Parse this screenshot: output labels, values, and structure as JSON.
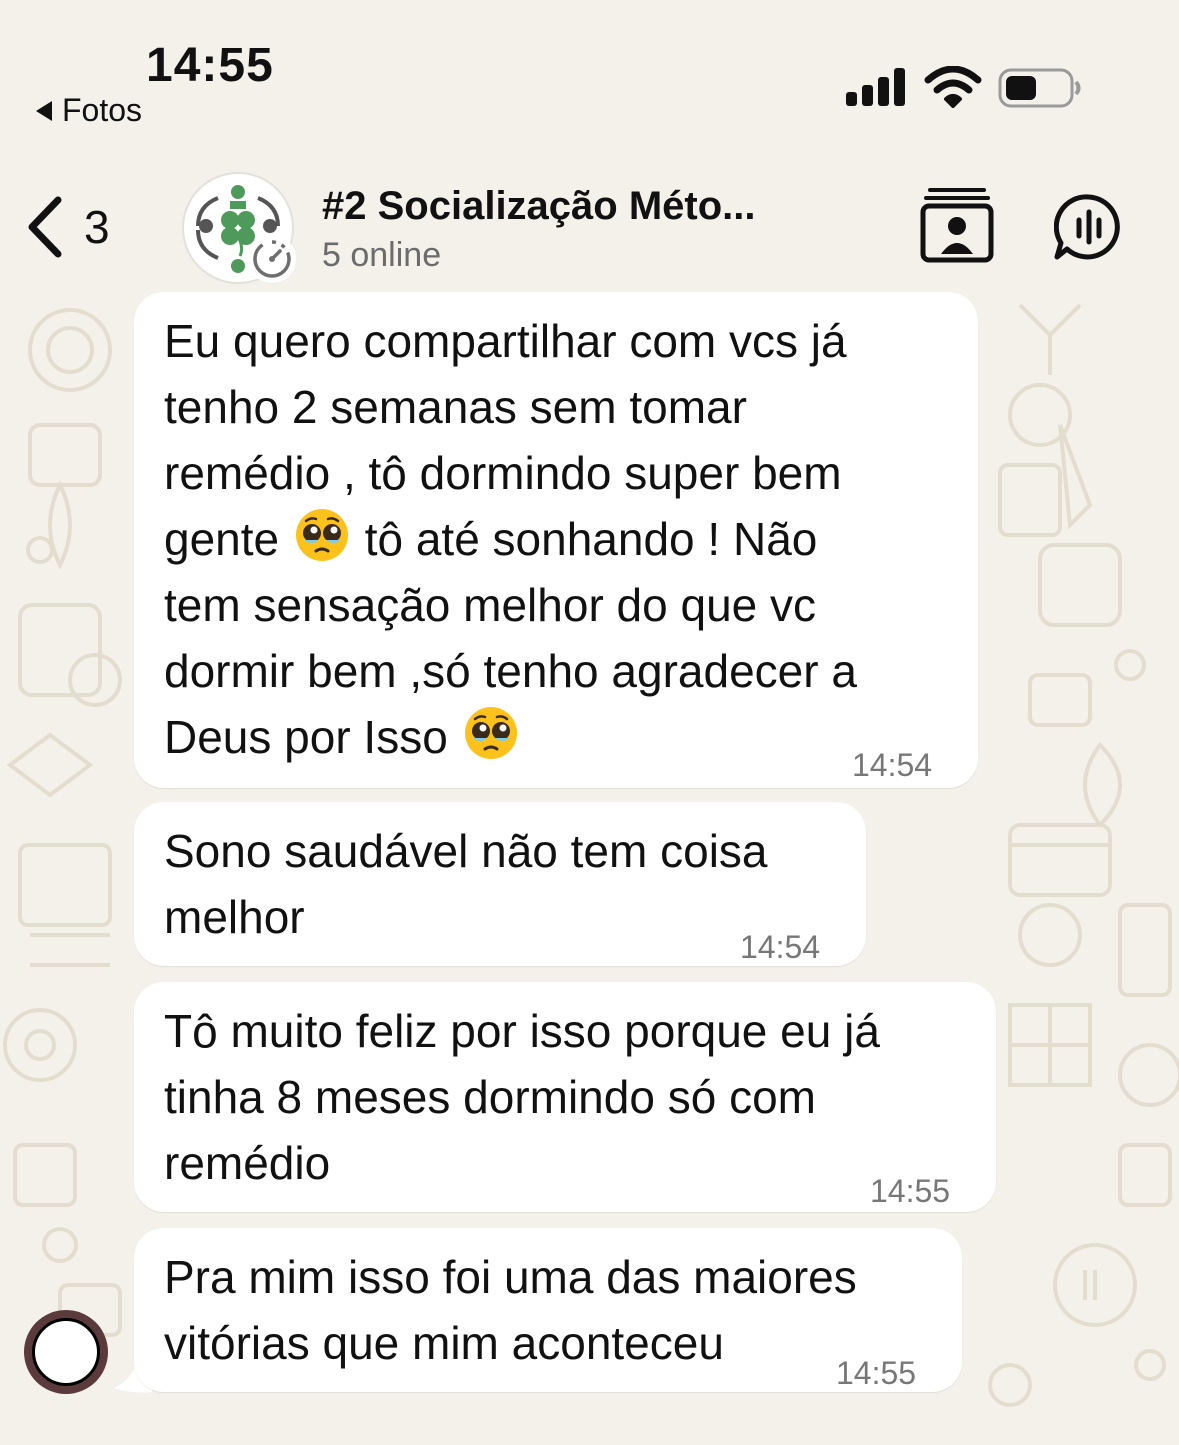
{
  "status_bar": {
    "time": "14:55",
    "back_app_label": "Fotos",
    "icons": [
      "signal-icon",
      "wifi-icon",
      "battery-icon"
    ]
  },
  "header": {
    "back_count": "3",
    "title": "#2 Socialização Méto...",
    "subtitle": "5 online",
    "icons": [
      "chevron-left-icon",
      "group-avatar",
      "disappearing-timer-icon",
      "contact-card-icon",
      "voice-chat-icon"
    ]
  },
  "messages": [
    {
      "lines": [
        "Eu quero compartilhar com vcs já",
        "tenho 2 semanas sem tomar",
        "remédio , tô dormindo super bem",
        "gente",
        "tô até sonhando ! Não",
        "tem sensação melhor do que vc",
        "dormir bem ,só tenho agradecer a",
        "Deus por Isso"
      ],
      "time": "14:54"
    },
    {
      "lines": [
        "Sono saudável não tem coisa",
        "melhor"
      ],
      "time": "14:54"
    },
    {
      "lines": [
        "Tô muito feliz por isso porque eu já",
        "tinha 8 meses dormindo só com",
        "remédio"
      ],
      "time": "14:55"
    },
    {
      "lines": [
        "Pra mim isso foi uma das maiores",
        "vitórias que mim aconteceu"
      ],
      "time": "14:55"
    }
  ],
  "emoji": "pleading-face",
  "colors": {
    "background": "#f4f1ea",
    "bubble": "#ffffff",
    "timestamp": "#777777",
    "subtitle": "#6b6b6b",
    "avatar_green": "#4e9a5b"
  }
}
